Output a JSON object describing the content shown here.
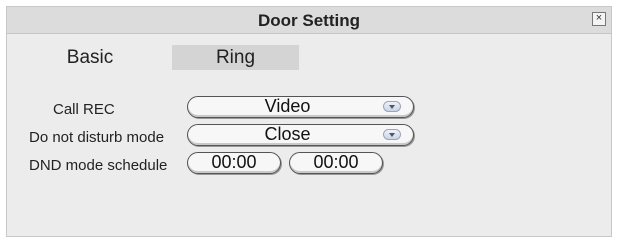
{
  "dialog": {
    "title": "Door Setting",
    "close_glyph": "×",
    "close_icon": "close-icon"
  },
  "tabs": [
    {
      "label": "Basic"
    },
    {
      "label": "Ring"
    }
  ],
  "form": {
    "call_rec": {
      "label": "Call REC",
      "value": "Video"
    },
    "dnd_mode": {
      "label": "Do not disturb mode",
      "value": "Close"
    },
    "dnd_schedule": {
      "label": "DND mode schedule",
      "start": "00:00",
      "end": "00:00"
    }
  }
}
